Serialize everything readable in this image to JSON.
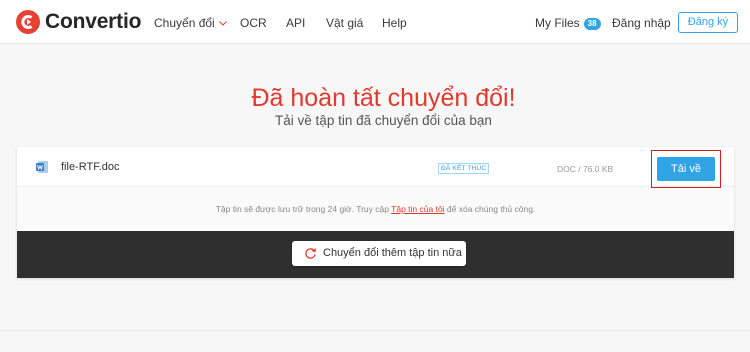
{
  "brand": {
    "name": "Convertio",
    "logo_color": "#e64133"
  },
  "nav": {
    "items": [
      {
        "label": "Chuyển đổi",
        "has_dropdown": true
      },
      {
        "label": "OCR"
      },
      {
        "label": "API"
      },
      {
        "label": "Vật giá"
      },
      {
        "label": "Help"
      }
    ]
  },
  "account": {
    "my_files_label": "My Files",
    "my_files_count": "38",
    "login_label": "Đăng nhập",
    "signup_label": "Đăng ký"
  },
  "hero": {
    "title": "Đã hoàn tất chuyển đổi!",
    "subtitle": "Tải về tập tin đã chuyển đổi của bạn"
  },
  "file": {
    "name": "file-RTF.doc",
    "icon": "word-document-icon",
    "status": "ĐÃ KẾT THÚC",
    "meta": "DOC / 76.0 KB",
    "download_label": "Tải về"
  },
  "notice": {
    "before": "Tập tin sẽ được lưu trữ trong 24 giờ. Truy cập ",
    "link": "Tập tin của tôi",
    "after": " để xóa chúng thủ công."
  },
  "actions": {
    "convert_more_label": "Chuyển đổi thêm tập tin nữa",
    "convert_more_icon": "refresh-icon"
  },
  "colors": {
    "accent": "#32a4e6",
    "title_red": "#e2392d",
    "dark_band": "#2f2f2f"
  }
}
